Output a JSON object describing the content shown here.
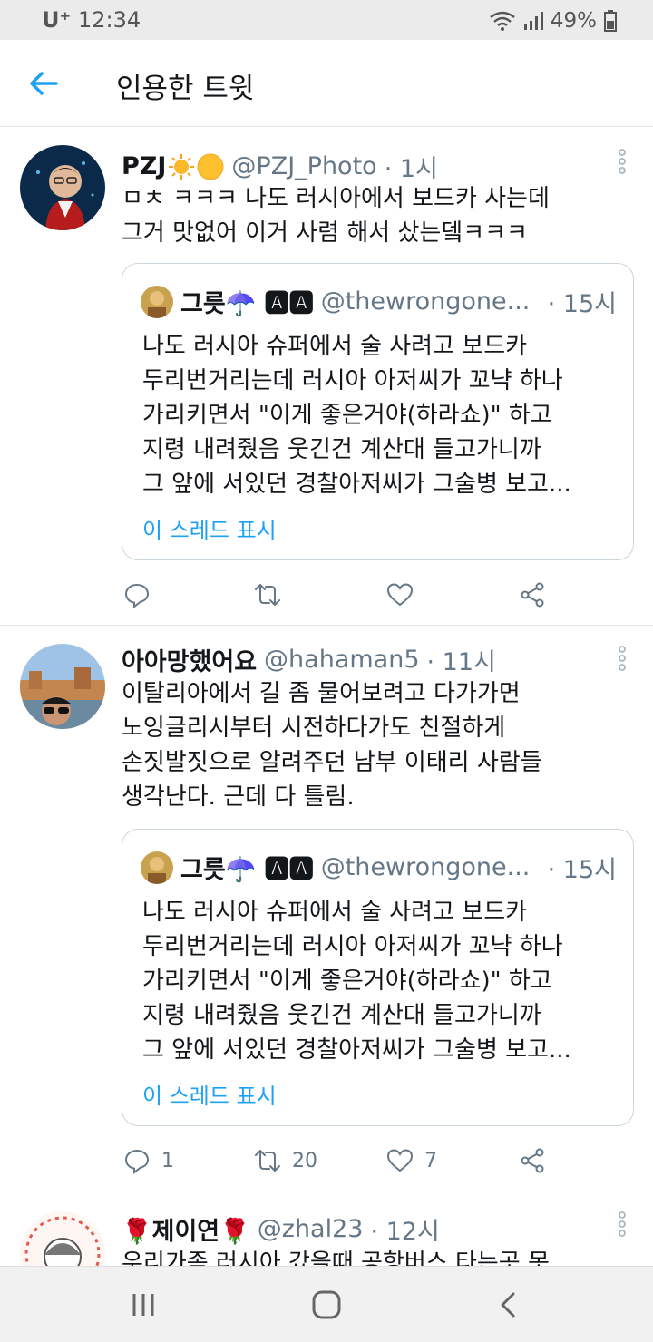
{
  "status_bar": {
    "carrier": "U⁺",
    "time": "12:34",
    "battery": "49%"
  },
  "header": {
    "title": "인용한 트윗"
  },
  "tweets": [
    {
      "display_name": "PZJ",
      "handle": "@PZJ_Photo",
      "time": "· 1시",
      "body": "ㅁㅊ ㅋㅋㅋ 나도 러시아에서 보드카 사는데\n그거 맛없어 이거 사렴 해서 샀는뎈ㅋㅋㅋ",
      "quote": {
        "name": "그릇☂️ 🅰🅰",
        "handle": "@thewrongone...",
        "time": "· 15시",
        "text": "나도 러시아 슈퍼에서 술 사려고 보드카\n두리번거리는데 러시아 아저씨가 꼬냑 하나\n가리키면서 \"이게 좋은거야(하라쇼)\" 하고\n지령 내려줬음 웃긴건 계산대 들고가니까\n그 앞에 서있던 경찰아저씨가 그술병 보고...",
        "thread_link": "이 스레드 표시"
      },
      "actions": {
        "reply": "",
        "retweet": "",
        "like": ""
      }
    },
    {
      "display_name": "아아망했어요",
      "handle": "@hahaman5",
      "time": "· 11시",
      "body": "이탈리아에서 길 좀 물어보려고 다가가면\n노잉글리시부터 시전하다가도 친절하게\n손짓발짓으로 알려주던 남부 이태리 사람들\n생각난다. 근데 다 틀림.",
      "quote": {
        "name": "그릇☂️ 🅰🅰",
        "handle": "@thewrongone...",
        "time": "· 15시",
        "text": "나도 러시아 슈퍼에서 술 사려고 보드카\n두리번거리는데 러시아 아저씨가 꼬냑 하나\n가리키면서 \"이게 좋은거야(하라쇼)\" 하고\n지령 내려줬음 웃긴건 계산대 들고가니까\n그 앞에 서있던 경찰아저씨가 그술병 보고...",
        "thread_link": "이 스레드 표시"
      },
      "actions": {
        "reply": "1",
        "retweet": "20",
        "like": "7"
      }
    },
    {
      "display_name": "🌹제이연🌹",
      "handle": "@zhal23",
      "time": "· 12시",
      "body": "우리가족 러시아 갔을때 공항버스 타는곳 못"
    }
  ],
  "icons": {
    "back": "arrow-left-icon",
    "more": "more-vertical-icon",
    "reply": "reply-icon",
    "retweet": "retweet-icon",
    "like": "heart-icon",
    "share": "share-icon"
  },
  "colors": {
    "accent": "#1da1f2",
    "muted": "#657786"
  }
}
